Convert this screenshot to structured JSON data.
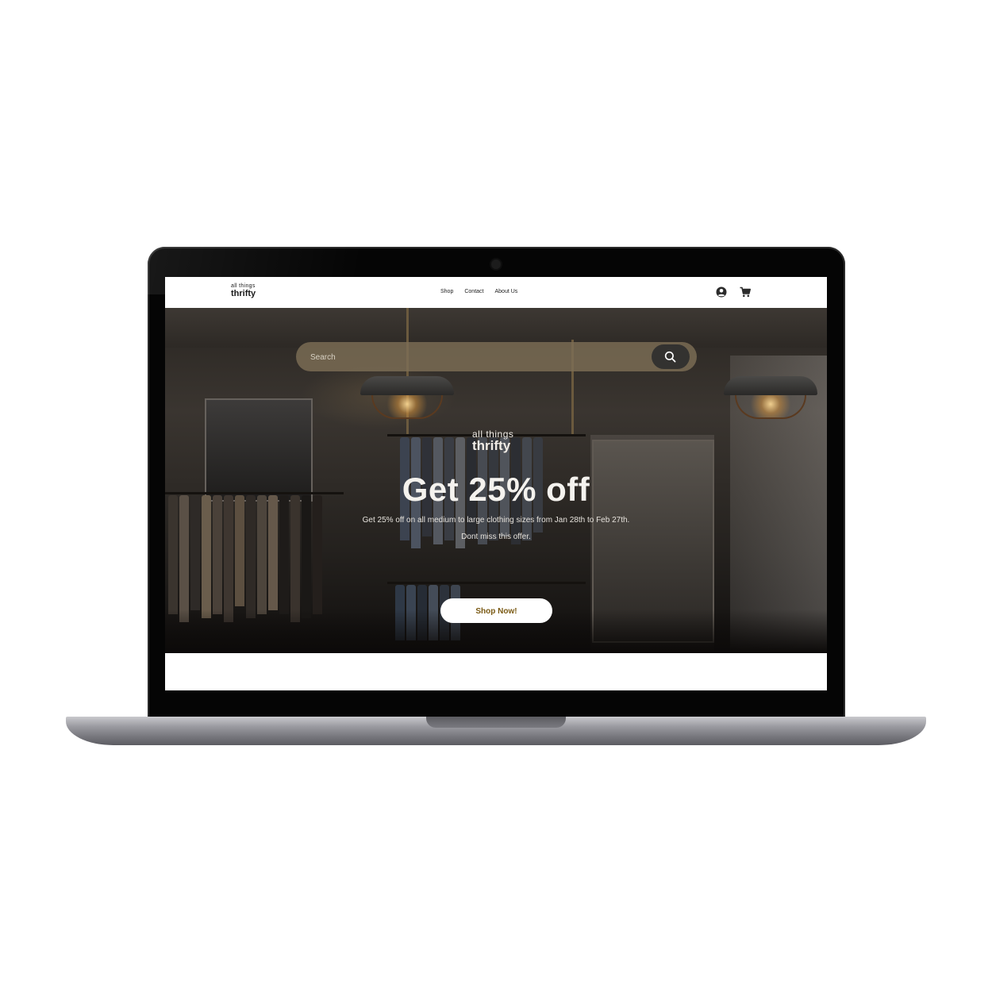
{
  "nav": {
    "logo_small": "all things",
    "logo_big": "thrifty",
    "links": [
      "Shop",
      "Contact",
      "About Us"
    ],
    "icons": [
      "user-icon",
      "cart-icon"
    ]
  },
  "hero": {
    "search_placeholder": "Search",
    "logo_small": "all things",
    "logo_big": "thrifty",
    "headline": "Get 25% off",
    "subtext_line1": "Get 25% off on all medium to large clothing sizes from Jan 28th to Feb 27th.",
    "subtext_line2": "Dont miss this offer.",
    "cta_label": "Shop Now!"
  },
  "colors": {
    "cta_text": "#7a5a14",
    "search_bg": "#7d6e55",
    "search_button": "#333230"
  }
}
